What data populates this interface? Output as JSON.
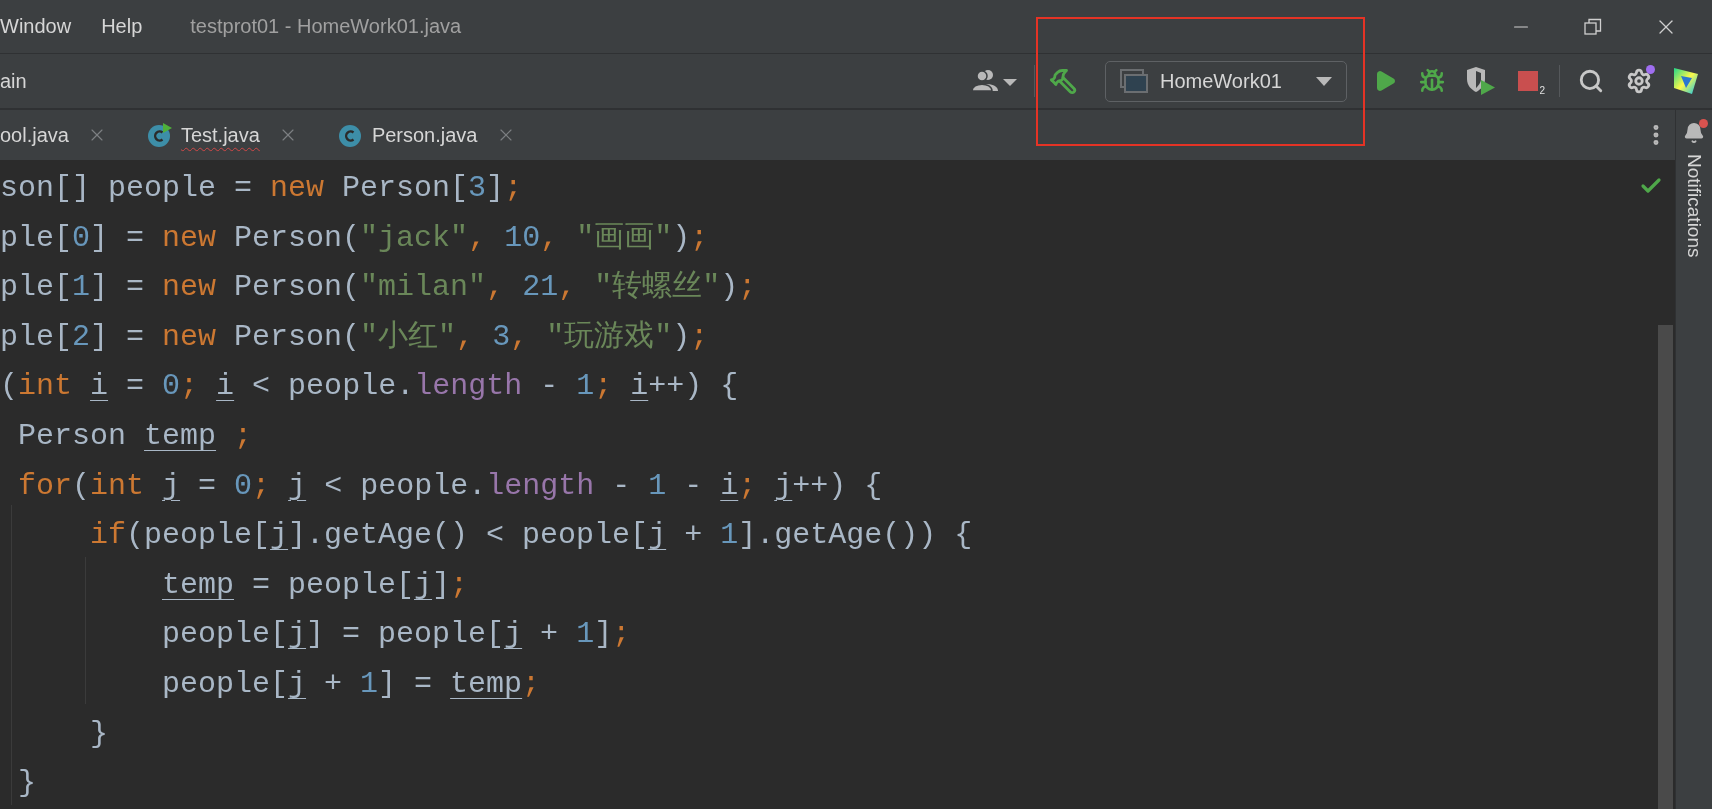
{
  "menu": [
    {
      "label": "Window"
    },
    {
      "label": "Help"
    }
  ],
  "window": {
    "title": "testprot01 - HomeWork01.java"
  },
  "breadcrumb": "ain",
  "toolbar": {
    "run_configuration": "HomeWork01",
    "stop_badge": "2",
    "settings_has_update": true
  },
  "tabs": [
    {
      "label": "ool.java",
      "kind": "plain",
      "has_error": false
    },
    {
      "label": "Test.java",
      "kind": "runnable-class",
      "has_error": true
    },
    {
      "label": "Person.java",
      "kind": "class",
      "has_error": false
    }
  ],
  "editor": {
    "inspection_ok": true,
    "lines": [
      {
        "tokens": [
          {
            "text": "son[] people = ",
            "kind": "plain"
          },
          {
            "text": "new",
            "kind": "keyword"
          },
          {
            "text": " Person[",
            "kind": "plain"
          },
          {
            "text": "3",
            "kind": "number"
          },
          {
            "text": "]",
            "kind": "plain"
          },
          {
            "text": ";",
            "kind": "punct"
          }
        ]
      },
      {
        "tokens": [
          {
            "text": "ple[",
            "kind": "plain"
          },
          {
            "text": "0",
            "kind": "number"
          },
          {
            "text": "] = ",
            "kind": "plain"
          },
          {
            "text": "new",
            "kind": "keyword"
          },
          {
            "text": " Person(",
            "kind": "plain"
          },
          {
            "text": "\"jack\"",
            "kind": "string"
          },
          {
            "text": ", ",
            "kind": "punct"
          },
          {
            "text": "10",
            "kind": "number"
          },
          {
            "text": ", ",
            "kind": "punct"
          },
          {
            "text": "\"画画\"",
            "kind": "string"
          },
          {
            "text": ")",
            "kind": "plain"
          },
          {
            "text": ";",
            "kind": "punct"
          }
        ]
      },
      {
        "tokens": [
          {
            "text": "ple[",
            "kind": "plain"
          },
          {
            "text": "1",
            "kind": "number"
          },
          {
            "text": "] = ",
            "kind": "plain"
          },
          {
            "text": "new",
            "kind": "keyword"
          },
          {
            "text": " Person(",
            "kind": "plain"
          },
          {
            "text": "\"milan\"",
            "kind": "string"
          },
          {
            "text": ", ",
            "kind": "punct"
          },
          {
            "text": "21",
            "kind": "number"
          },
          {
            "text": ", ",
            "kind": "punct"
          },
          {
            "text": "\"转螺丝\"",
            "kind": "string"
          },
          {
            "text": ")",
            "kind": "plain"
          },
          {
            "text": ";",
            "kind": "punct"
          }
        ]
      },
      {
        "tokens": [
          {
            "text": "ple[",
            "kind": "plain"
          },
          {
            "text": "2",
            "kind": "number"
          },
          {
            "text": "] = ",
            "kind": "plain"
          },
          {
            "text": "new",
            "kind": "keyword"
          },
          {
            "text": " Person(",
            "kind": "plain"
          },
          {
            "text": "\"小红\"",
            "kind": "string"
          },
          {
            "text": ", ",
            "kind": "punct"
          },
          {
            "text": "3",
            "kind": "number"
          },
          {
            "text": ", ",
            "kind": "punct"
          },
          {
            "text": "\"玩游戏\"",
            "kind": "string"
          },
          {
            "text": ")",
            "kind": "plain"
          },
          {
            "text": ";",
            "kind": "punct"
          }
        ]
      },
      {
        "tokens": [
          {
            "text": "(",
            "kind": "plain"
          },
          {
            "text": "int ",
            "kind": "keyword"
          },
          {
            "text": "i",
            "kind": "variable"
          },
          {
            "text": " = ",
            "kind": "plain"
          },
          {
            "text": "0",
            "kind": "number"
          },
          {
            "text": "; ",
            "kind": "punct"
          },
          {
            "text": "i",
            "kind": "variable"
          },
          {
            "text": " < people.",
            "kind": "plain"
          },
          {
            "text": "length",
            "kind": "field"
          },
          {
            "text": " - ",
            "kind": "plain"
          },
          {
            "text": "1",
            "kind": "number"
          },
          {
            "text": "; ",
            "kind": "punct"
          },
          {
            "text": "i",
            "kind": "variable"
          },
          {
            "text": "++) {",
            "kind": "plain"
          }
        ],
        "children": [
          {
            "tokens": [
              {
                "text": "Person ",
                "kind": "plain"
              },
              {
                "text": "temp",
                "kind": "variable"
              },
              {
                "text": " ;",
                "kind": "punct"
              }
            ]
          },
          {
            "tokens": [
              {
                "text": "for",
                "kind": "keyword"
              },
              {
                "text": "(",
                "kind": "plain"
              },
              {
                "text": "int ",
                "kind": "keyword"
              },
              {
                "text": "j",
                "kind": "variable"
              },
              {
                "text": " = ",
                "kind": "plain"
              },
              {
                "text": "0",
                "kind": "number"
              },
              {
                "text": "; ",
                "kind": "punct"
              },
              {
                "text": "j",
                "kind": "variable"
              },
              {
                "text": " < people.",
                "kind": "plain"
              },
              {
                "text": "length",
                "kind": "field"
              },
              {
                "text": " - ",
                "kind": "plain"
              },
              {
                "text": "1",
                "kind": "number"
              },
              {
                "text": " - ",
                "kind": "plain"
              },
              {
                "text": "i",
                "kind": "variable"
              },
              {
                "text": "; ",
                "kind": "punct"
              },
              {
                "text": "j",
                "kind": "variable"
              },
              {
                "text": "++) {",
                "kind": "plain"
              }
            ],
            "children": [
              {
                "tokens": [
                  {
                    "text": "if",
                    "kind": "keyword"
                  },
                  {
                    "text": "(people[",
                    "kind": "plain"
                  },
                  {
                    "text": "j",
                    "kind": "variable"
                  },
                  {
                    "text": "].getAge() < people[",
                    "kind": "plain"
                  },
                  {
                    "text": "j",
                    "kind": "variable"
                  },
                  {
                    "text": " + ",
                    "kind": "plain"
                  },
                  {
                    "text": "1",
                    "kind": "number"
                  },
                  {
                    "text": "].getAge()) {",
                    "kind": "plain"
                  }
                ],
                "children": [
                  {
                    "tokens": [
                      {
                        "text": "temp",
                        "kind": "variable"
                      },
                      {
                        "text": " = people[",
                        "kind": "plain"
                      },
                      {
                        "text": "j",
                        "kind": "variable"
                      },
                      {
                        "text": "]",
                        "kind": "plain"
                      },
                      {
                        "text": ";",
                        "kind": "punct"
                      }
                    ]
                  },
                  {
                    "tokens": [
                      {
                        "text": "people[",
                        "kind": "plain"
                      },
                      {
                        "text": "j",
                        "kind": "variable"
                      },
                      {
                        "text": "] = people[",
                        "kind": "plain"
                      },
                      {
                        "text": "j",
                        "kind": "variable"
                      },
                      {
                        "text": " + ",
                        "kind": "plain"
                      },
                      {
                        "text": "1",
                        "kind": "number"
                      },
                      {
                        "text": "]",
                        "kind": "plain"
                      },
                      {
                        "text": ";",
                        "kind": "punct"
                      }
                    ]
                  },
                  {
                    "tokens": [
                      {
                        "text": "people[",
                        "kind": "plain"
                      },
                      {
                        "text": "j",
                        "kind": "variable"
                      },
                      {
                        "text": " + ",
                        "kind": "plain"
                      },
                      {
                        "text": "1",
                        "kind": "number"
                      },
                      {
                        "text": "] = ",
                        "kind": "plain"
                      },
                      {
                        "text": "temp",
                        "kind": "variable"
                      },
                      {
                        "text": ";",
                        "kind": "punct"
                      }
                    ]
                  }
                ]
              },
              {
                "tokens": [
                  {
                    "text": "}",
                    "kind": "plain"
                  }
                ]
              }
            ]
          },
          {
            "tokens": [
              {
                "text": "}",
                "kind": "plain"
              }
            ]
          }
        ]
      }
    ]
  },
  "notifications": {
    "label": "Notifications",
    "unread": true
  }
}
